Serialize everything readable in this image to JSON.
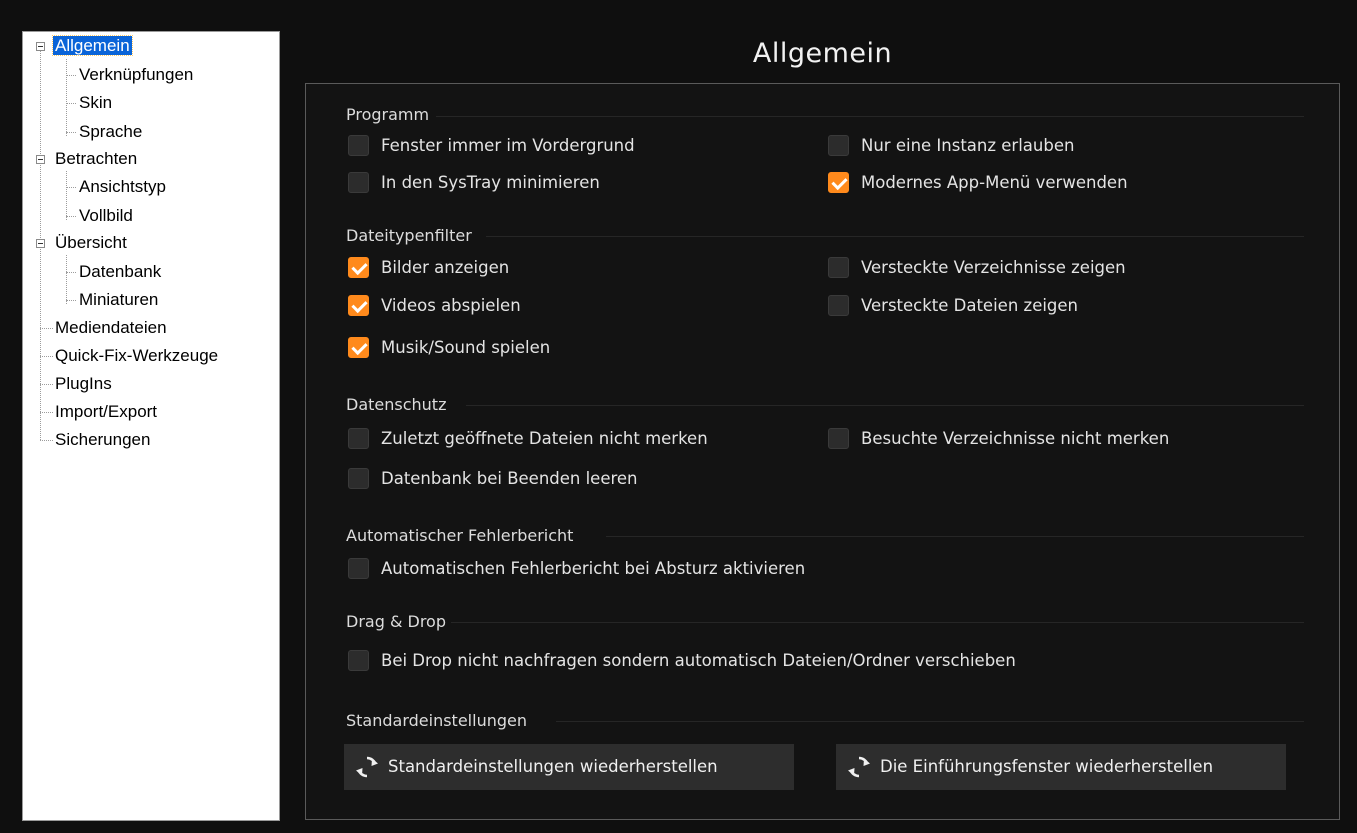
{
  "accent_color": "#ff8a1c",
  "tree": {
    "items": [
      {
        "label": "Allgemein",
        "level": 0,
        "expander": true,
        "selected": true
      },
      {
        "label": "Verknüpfungen",
        "level": 1
      },
      {
        "label": "Skin",
        "level": 1
      },
      {
        "label": "Sprache",
        "level": 1
      },
      {
        "label": "Betrachten",
        "level": 0,
        "expander": true
      },
      {
        "label": "Ansichtstyp",
        "level": 1
      },
      {
        "label": "Vollbild",
        "level": 1
      },
      {
        "label": "Übersicht",
        "level": 0,
        "expander": true
      },
      {
        "label": "Datenbank",
        "level": 1
      },
      {
        "label": "Miniaturen",
        "level": 1
      },
      {
        "label": "Mediendateien",
        "level": 0
      },
      {
        "label": "Quick-Fix-Werkzeuge",
        "level": 0
      },
      {
        "label": "PlugIns",
        "level": 0
      },
      {
        "label": "Import/Export",
        "level": 0
      },
      {
        "label": "Sicherungen",
        "level": 0
      }
    ]
  },
  "page": {
    "title": "Allgemein"
  },
  "sections": {
    "programm": {
      "title": "Programm",
      "options": [
        {
          "label": "Fenster immer im Vordergrund",
          "checked": false
        },
        {
          "label": "Nur eine Instanz erlauben",
          "checked": false
        },
        {
          "label": "In den SysTray minimieren",
          "checked": false
        },
        {
          "label": "Modernes App-Menü verwenden",
          "checked": true
        }
      ]
    },
    "dateityp": {
      "title": "Dateitypenfilter",
      "options": [
        {
          "label": "Bilder anzeigen",
          "checked": true
        },
        {
          "label": "Versteckte Verzeichnisse zeigen",
          "checked": false
        },
        {
          "label": "Videos abspielen",
          "checked": true
        },
        {
          "label": "Versteckte Dateien zeigen",
          "checked": false
        },
        {
          "label": "Musik/Sound spielen",
          "checked": true
        }
      ]
    },
    "datenschutz": {
      "title": "Datenschutz",
      "options": [
        {
          "label": "Zuletzt geöffnete Dateien nicht merken",
          "checked": false
        },
        {
          "label": "Besuchte Verzeichnisse nicht merken",
          "checked": false
        },
        {
          "label": "Datenbank bei Beenden leeren",
          "checked": false
        }
      ]
    },
    "fehlerbericht": {
      "title": "Automatischer Fehlerbericht",
      "options": [
        {
          "label": "Automatischen Fehlerbericht bei Absturz aktivieren",
          "checked": false
        }
      ]
    },
    "dragdrop": {
      "title": "Drag & Drop",
      "options": [
        {
          "label": "Bei Drop nicht nachfragen sondern automatisch Dateien/Ordner verschieben",
          "checked": false
        }
      ]
    },
    "standard": {
      "title": "Standardeinstellungen",
      "buttons": [
        {
          "label": "Standardeinstellungen wiederherstellen",
          "icon": "refresh-icon"
        },
        {
          "label": "Die Einführungsfenster wiederherstellen",
          "icon": "refresh-icon"
        }
      ]
    }
  }
}
